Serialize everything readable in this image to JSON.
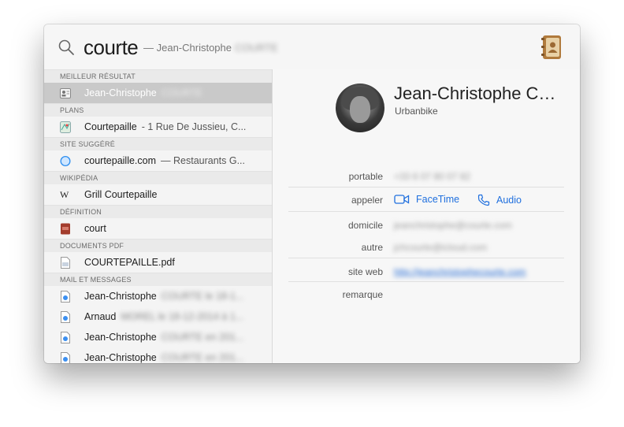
{
  "search": {
    "query": "courte",
    "completion_prefix": "— Jean-Christophe",
    "completion_hidden": "COURTE"
  },
  "results": {
    "sections": [
      {
        "header": "MEILLEUR RÉSULTAT",
        "items": [
          {
            "label": "Jean-Christophe",
            "hidden": "COURTE",
            "icon": "contact-card-icon",
            "selected": true
          }
        ]
      },
      {
        "header": "PLANS",
        "items": [
          {
            "label": "Courtepaille",
            "sub": "- 1 Rue De Jussieu, C...",
            "icon": "maps-icon"
          }
        ]
      },
      {
        "header": "SITE SUGGÉRÉ",
        "items": [
          {
            "label": "courtepaille.com",
            "sub": "— Restaurants G...",
            "icon": "safari-icon"
          }
        ]
      },
      {
        "header": "WIKIPÉDIA",
        "items": [
          {
            "label": "Grill Courtepaille",
            "icon": "wikipedia-icon"
          }
        ]
      },
      {
        "header": "DÉFINITION",
        "items": [
          {
            "label": "court",
            "icon": "dictionary-icon"
          }
        ]
      },
      {
        "header": "DOCUMENTS PDF",
        "items": [
          {
            "label": "COURTEPAILLE.pdf",
            "icon": "pdf-document-icon"
          }
        ]
      },
      {
        "header": "MAIL ET MESSAGES",
        "items": [
          {
            "label": "Jean-Christophe",
            "hidden": "COURTE le 18-1...",
            "icon": "mail-document-icon"
          },
          {
            "label": "Arnaud",
            "hidden": "MOREL le 18-12-2014 à 1...",
            "icon": "mail-document-icon"
          },
          {
            "label": "Jean-Christophe",
            "hidden": "COURTE en 201...",
            "icon": "mail-document-icon"
          },
          {
            "label": "Jean-Christophe",
            "hidden": "COURTE en 201...",
            "icon": "mail-document-icon"
          }
        ]
      }
    ]
  },
  "contact": {
    "name": "Jean-Christophe C…",
    "company": "Urbanbike",
    "fields": {
      "portable_label": "portable",
      "portable_value": "+33 6 07 80 07 82",
      "appeler_label": "appeler",
      "facetime_label": "FaceTime",
      "audio_label": "Audio",
      "domicile_label": "domicile",
      "domicile_value": "jeanchristophe@courte.com",
      "autre_label": "autre",
      "autre_value": "jchcourte@icloud.com",
      "siteweb_label": "site web",
      "siteweb_value": "http://jeanchristophecourte.com",
      "remarque_label": "remarque"
    }
  },
  "colors": {
    "accent": "#1f6fde",
    "selection": "#c9c9c9"
  }
}
